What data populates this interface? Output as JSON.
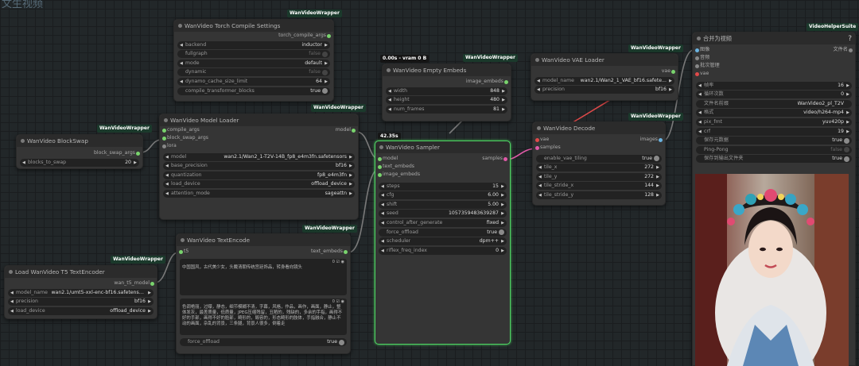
{
  "page": {
    "title": "文生视频"
  },
  "badges": {
    "wrapper": "WanVideoWrapper",
    "vhs": "VideoHelperSuite",
    "vram": "0.00s - vram 0 B",
    "time": "42.35s"
  },
  "torch": {
    "title": "WanVideo Torch Compile Settings",
    "out": "torch_compile_args",
    "backend": {
      "label": "backend",
      "value": "inductor"
    },
    "fullgraph": {
      "label": "fullgraph",
      "value": "false"
    },
    "mode": {
      "label": "mode",
      "value": "default"
    },
    "dynamic": {
      "label": "dynamic",
      "value": "false"
    },
    "dynamo": {
      "label": "dynamo_cache_size_limit",
      "value": "64"
    },
    "compile_tb": {
      "label": "compile_transformer_blocks",
      "value": "true"
    }
  },
  "blockswap": {
    "title": "WanVideo BlockSwap",
    "out": "block_swap_args",
    "blocks": {
      "label": "blocks_to_swap",
      "value": "20"
    }
  },
  "loader": {
    "title": "WanVideo Model Loader",
    "in1": "compile_args",
    "in2": "block_swap_args",
    "in3": "lora",
    "out": "model",
    "model": {
      "label": "model",
      "value": "wan2.1/Wan2_1-T2V-14B_fp8_e4m3fn.safetensors"
    },
    "base_precision": {
      "label": "base_precision",
      "value": "bf16"
    },
    "quantization": {
      "label": "quantization",
      "value": "fp8_e4m3fn"
    },
    "load_device": {
      "label": "load_device",
      "value": "offload_device"
    },
    "attention": {
      "label": "attention_mode",
      "value": "sageattn"
    }
  },
  "t5": {
    "title": "Load WanVideo T5 TextEncoder",
    "out": "wan_t5_model",
    "model_name": {
      "label": "model_name",
      "value": "wan2.1/umt5-xxl-enc-bf16.safetensors"
    },
    "precision": {
      "label": "precision",
      "value": "bf16"
    },
    "load_device": {
      "label": "load_device",
      "value": "offload_device"
    }
  },
  "textenc": {
    "title": "WanVideo TextEncode",
    "in": "t5",
    "out": "text_embeds",
    "positive": "中国国风，古代美少女，头戴清朝传统宫廷饰品，转身看向镜头",
    "negative": "色调艳丽，过曝，静态，细节模糊不清，字幕，风格，作品，画作，画面，静止，整体发灰，最差质量，低质量，JPEG压缩残留，丑陋的，残缺的，多余的手指，画得不好的手部，画得不好的脸部，畸形的，毁容的，形态畸形的肢体，手指融合，静止不动的画面，杂乱的背景，三条腿，背景人很多，倒着走",
    "force_offload": {
      "label": "force_offload",
      "value": "true"
    }
  },
  "empty": {
    "title": "WanVideo Empty Embeds",
    "out": "image_embeds",
    "width": {
      "label": "width",
      "value": "848"
    },
    "height": {
      "label": "height",
      "value": "480"
    },
    "num_frames": {
      "label": "num_frames",
      "value": "81"
    }
  },
  "sampler": {
    "title": "WanVideo Sampler",
    "in1": "model",
    "in2": "text_embeds",
    "in3": "image_embeds",
    "out": "samples",
    "steps": {
      "label": "steps",
      "value": "15"
    },
    "cfg": {
      "label": "cfg",
      "value": "6.00"
    },
    "shift": {
      "label": "shift",
      "value": "5.00"
    },
    "seed": {
      "label": "seed",
      "value": "1057359483639287"
    },
    "control": {
      "label": "control_after_generate",
      "value": "fixed"
    },
    "force_offload": {
      "label": "force_offload",
      "value": "true"
    },
    "scheduler": {
      "label": "scheduler",
      "value": "dpm++"
    },
    "riflex": {
      "label": "riflex_freq_index",
      "value": "0"
    }
  },
  "vae": {
    "title": "WanVideo VAE Loader",
    "out": "vae",
    "model_name": {
      "label": "model_name",
      "value": "wan2.1/Wan2_1_VAE_bf16.safete..."
    },
    "precision": {
      "label": "precision",
      "value": "bf16"
    }
  },
  "decode": {
    "title": "WanVideo Decode",
    "in1": "vae",
    "in2": "samples",
    "out": "images",
    "tiling": {
      "label": "enable_vae_tiling",
      "value": "true"
    },
    "tile_x": {
      "label": "tile_x",
      "value": "272"
    },
    "tile_y": {
      "label": "tile_y",
      "value": "272"
    },
    "stride_x": {
      "label": "tile_stride_x",
      "value": "144"
    },
    "stride_y": {
      "label": "tile_stride_y",
      "value": "128"
    }
  },
  "combine": {
    "title": "合并为视频",
    "help": "?",
    "in1": "图像",
    "in2": "音频",
    "in3": "批次管理",
    "in4": "vae",
    "out": "文件名",
    "frame_rate": {
      "label": "帧率",
      "value": "16"
    },
    "loop": {
      "label": "循环次数",
      "value": "0"
    },
    "prefix": {
      "label": "文件名前缀",
      "value": "WanVideo2_pl_T2V"
    },
    "format": {
      "label": "格式",
      "value": "video/h264-mp4"
    },
    "pix_fmt": {
      "label": "pix_fmt",
      "value": "yuv420p"
    },
    "crf": {
      "label": "crf",
      "value": "19"
    },
    "metadata": {
      "label": "保存元数据",
      "value": "true"
    },
    "pingpong": {
      "label": "Ping-Pong",
      "value": "false"
    },
    "save_output": {
      "label": "保存到输出文件夹",
      "value": "true"
    }
  }
}
